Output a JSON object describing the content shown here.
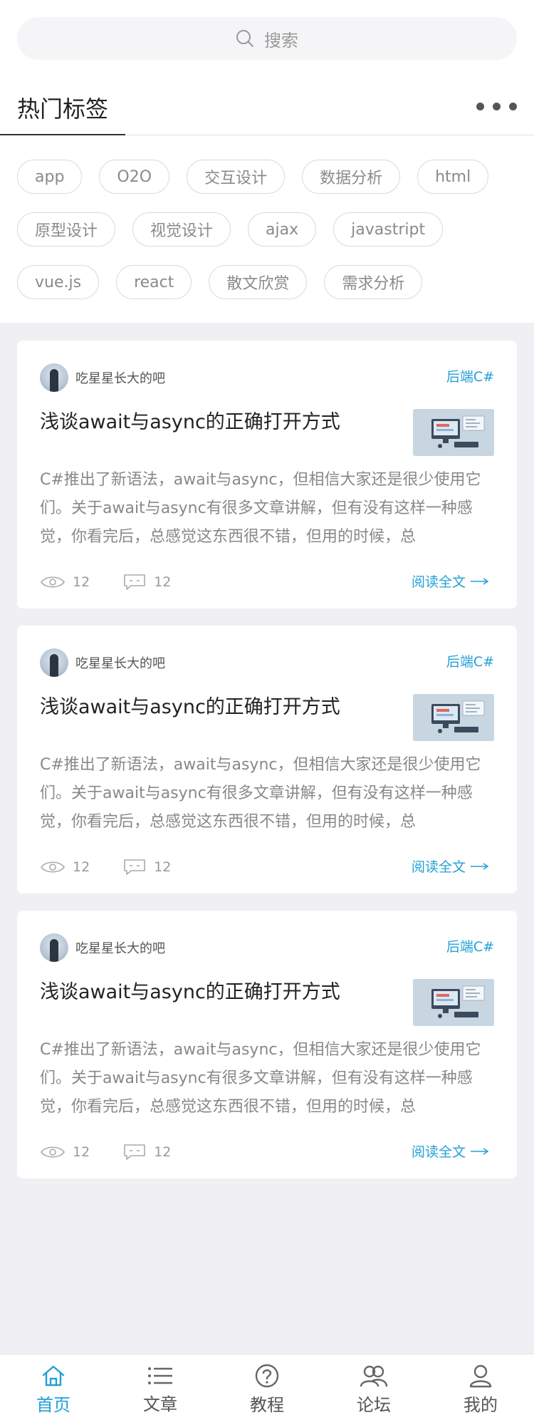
{
  "search": {
    "placeholder": "搜索",
    "icon": "search-icon"
  },
  "hot_tags": {
    "title": "热门标签",
    "rows": [
      [
        "app",
        "O2O",
        "交互设计",
        "数据分析",
        "html"
      ],
      [
        "原型设计",
        "视觉设计",
        "ajax",
        "javastript"
      ],
      [
        "vue.js",
        "react",
        "散文欣赏",
        "需求分析"
      ]
    ]
  },
  "articles": [
    {
      "author": "吃星星长大的吧",
      "category": "后端C#",
      "title": "浅谈await与async的正确打开方式",
      "excerpt": "C#推出了新语法，await与async，但相信大家还是很少使用它们。关于await与async有很多文章讲解，但有没有这样一种感觉，你看完后，总感觉这东西很不错，但用的时候，总",
      "views": "12",
      "comments": "12",
      "read_more": "阅读全文"
    },
    {
      "author": "吃星星长大的吧",
      "category": "后端C#",
      "title": "浅谈await与async的正确打开方式",
      "excerpt": "C#推出了新语法，await与async，但相信大家还是很少使用它们。关于await与async有很多文章讲解，但有没有这样一种感觉，你看完后，总感觉这东西很不错，但用的时候，总",
      "views": "12",
      "comments": "12",
      "read_more": "阅读全文"
    },
    {
      "author": "吃星星长大的吧",
      "category": "后端C#",
      "title": "浅谈await与async的正确打开方式",
      "excerpt": "C#推出了新语法，await与async，但相信大家还是很少使用它们。关于await与async有很多文章讲解，但有没有这样一种感觉，你看完后，总感觉这东西很不错，但用的时候，总",
      "views": "12",
      "comments": "12",
      "read_more": "阅读全文"
    }
  ],
  "tabbar": {
    "items": [
      {
        "label": "首页",
        "icon": "home-icon",
        "active": true
      },
      {
        "label": "文章",
        "icon": "list-icon",
        "active": false
      },
      {
        "label": "教程",
        "icon": "question-icon",
        "active": false
      },
      {
        "label": "论坛",
        "icon": "group-icon",
        "active": false
      },
      {
        "label": "我的",
        "icon": "user-icon",
        "active": false
      }
    ]
  },
  "colors": {
    "accent": "#22a0d6",
    "background": "#efeff4"
  }
}
